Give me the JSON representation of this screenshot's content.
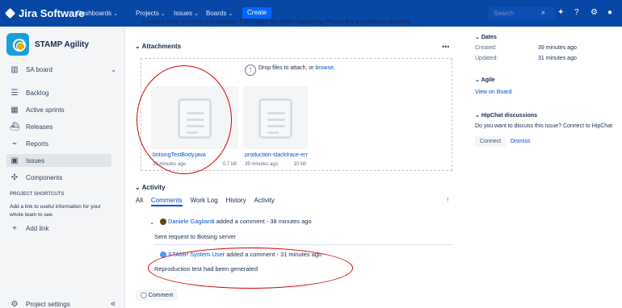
{
  "app": {
    "name": "Jira Software",
    "top_nav": [
      {
        "label": "Dashboards"
      },
      {
        "label": "Projects"
      },
      {
        "label": "Issues"
      },
      {
        "label": "Boards"
      }
    ],
    "create_label": "Create",
    "search_placeholder": "Search"
  },
  "sidebar": {
    "project_name": "STAMP Agility",
    "board_label": "SA board",
    "items": [
      {
        "label": "Backlog",
        "icon": "backlog-icon"
      },
      {
        "label": "Active sprints",
        "icon": "sprint-board-icon"
      },
      {
        "label": "Releases",
        "icon": "ship-icon"
      },
      {
        "label": "Reports",
        "icon": "chart-icon"
      },
      {
        "label": "Issues",
        "icon": "issues-icon"
      },
      {
        "label": "Components",
        "icon": "puzzle-icon"
      }
    ],
    "shortcuts_title": "PROJECT SHORTCUTS",
    "shortcuts_text": "Add a link to useful information for your whole team to see.",
    "add_link": "Add link",
    "settings": "Project settings"
  },
  "issue": {
    "truncated_description": "A runtime error occurred in production. Can't figure out what's happening. Please find a stacktrace attached.",
    "attachments_title": "Attachments",
    "dropzone_text": "Drop files to attach, or",
    "browse_label": "browse.",
    "attachments": [
      {
        "name": "botsingTestBody.java",
        "time": "31 minutes ago",
        "size": "0.7 kB"
      },
      {
        "name": "production-stacktrace-error.",
        "time": "39 minutes ago",
        "size": "10 kB"
      }
    ],
    "activity_title": "Activity",
    "tabs": [
      "All",
      "Comments",
      "Work Log",
      "History",
      "Activity"
    ],
    "comments": [
      {
        "author": "Daniele Gagliardi",
        "meta": "added a comment - 38 minutes ago",
        "body": "Sent request to Botsing server"
      },
      {
        "author": "STAMP System User",
        "meta": "added a comment - 31 minutes ago",
        "body": "Reproduction test had been generated"
      }
    ],
    "comment_button": "Comment"
  },
  "details": {
    "dates_title": "Dates",
    "created_label": "Created:",
    "created_value": "39 minutes ago",
    "updated_label": "Updated:",
    "updated_value": "31 minutes ago",
    "agile_title": "Agile",
    "view_on_board": "View on Board",
    "hipchat_title": "HipChat discussions",
    "hipchat_text": "Do you want to discuss this issue? Connect to HipChat",
    "connect": "Connect",
    "dismiss": "Dismiss"
  },
  "colors": {
    "header": "#0747A6",
    "primary": "#0052CC",
    "annotation": "#D50000"
  }
}
